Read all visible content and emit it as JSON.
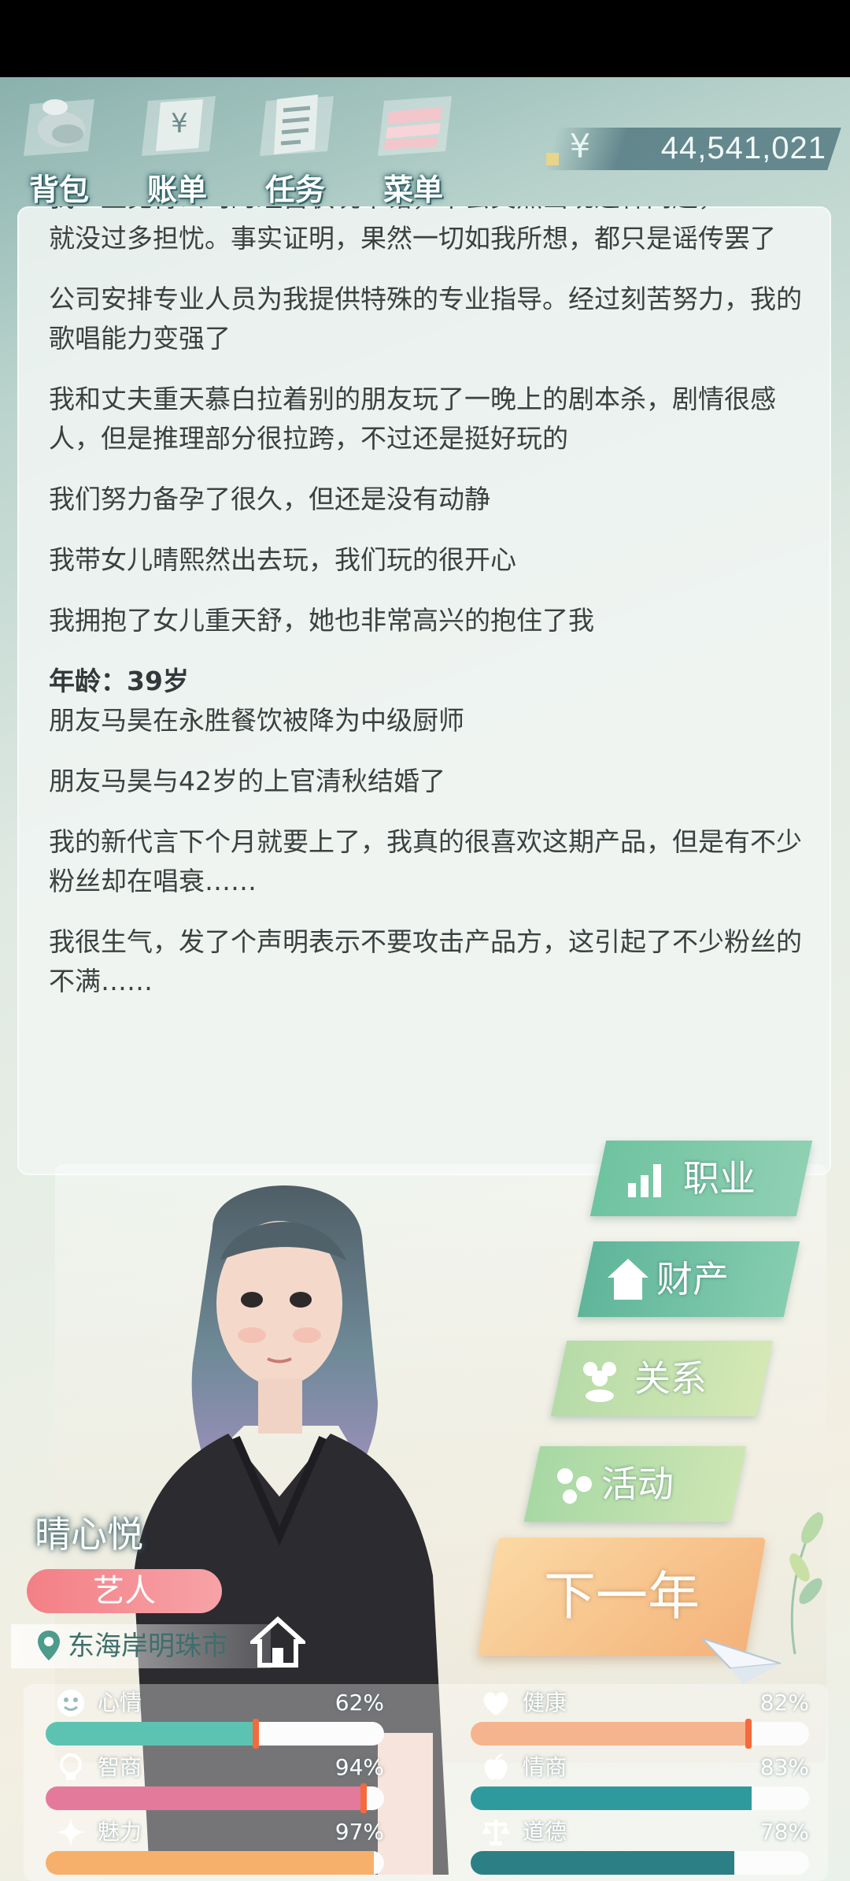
{
  "toolbar": {
    "items": [
      {
        "label": "背包",
        "icon": "backpack-icon"
      },
      {
        "label": "账单",
        "icon": "bill-icon"
      },
      {
        "label": "任务",
        "icon": "task-icon"
      },
      {
        "label": "菜单",
        "icon": "menu-icon"
      }
    ],
    "money_symbol": "¥",
    "money": "44,541,021"
  },
  "log": {
    "entries_top": [
      "就没过多担忧。事实证明，果然一切如我所想，都只是谣传罢了",
      "公司安排专业人员为我提供特殊的专业指导。经过刻苦努力，我的歌唱能力变强了",
      "我和丈夫重天慕白拉着别的朋友玩了一晚上的剧本杀，剧情很感人，但是推理部分很拉跨，不过还是挺好玩的",
      "我们努力备孕了很久，但还是没有动静",
      "我带女儿晴熙然出去玩，我们玩的很开心",
      "我拥抱了女儿重天舒，她也非常高兴的抱住了我"
    ],
    "partial_first_line": "我一直觉得公司的经营状况不错，不会突然出现这种问题，",
    "age_label": "年龄：39岁",
    "entries_bottom": [
      "朋友马昊在永胜餐饮被降为中级厨师",
      "朋友马昊与42岁的上官清秋结婚了",
      "我的新代言下个月就要上了，我真的很喜欢这期产品，但是有不少粉丝却在唱衰……",
      "我很生气，发了个声明表示不要攻击产品方，这引起了不少粉丝的不满……"
    ]
  },
  "actions": {
    "career": "职业",
    "property": "财产",
    "relations": "关系",
    "activity": "活动",
    "next_year": "下一年"
  },
  "character": {
    "name": "晴心悦",
    "job": "艺人",
    "location": "东海岸明珠市"
  },
  "stats": [
    {
      "label": "心情",
      "value": "62%",
      "level": 0.62,
      "icon": "smile-icon",
      "color": "#5cc3b3"
    },
    {
      "label": "健康",
      "value": "82%",
      "level": 0.82,
      "icon": "heart-icon",
      "color": "#f6b48e"
    },
    {
      "label": "智商",
      "value": "94%",
      "level": 0.94,
      "icon": "bulb-icon",
      "color": "#e37a9c"
    },
    {
      "label": "情商",
      "value": "83%",
      "level": 0.83,
      "icon": "apple-icon",
      "color": "#2f9a9e"
    },
    {
      "label": "魅力",
      "value": "97%",
      "level": 0.97,
      "icon": "star-icon",
      "color": "#f6b06b"
    },
    {
      "label": "道德",
      "value": "78%",
      "level": 0.78,
      "icon": "scale-icon",
      "color": "#2d7f86"
    }
  ],
  "colors": {
    "accent_teal": "#5cc3b3",
    "button_green": "#6fc3a0",
    "next_year_orange": "#f4b27a",
    "job_pink": "#f37f86"
  }
}
